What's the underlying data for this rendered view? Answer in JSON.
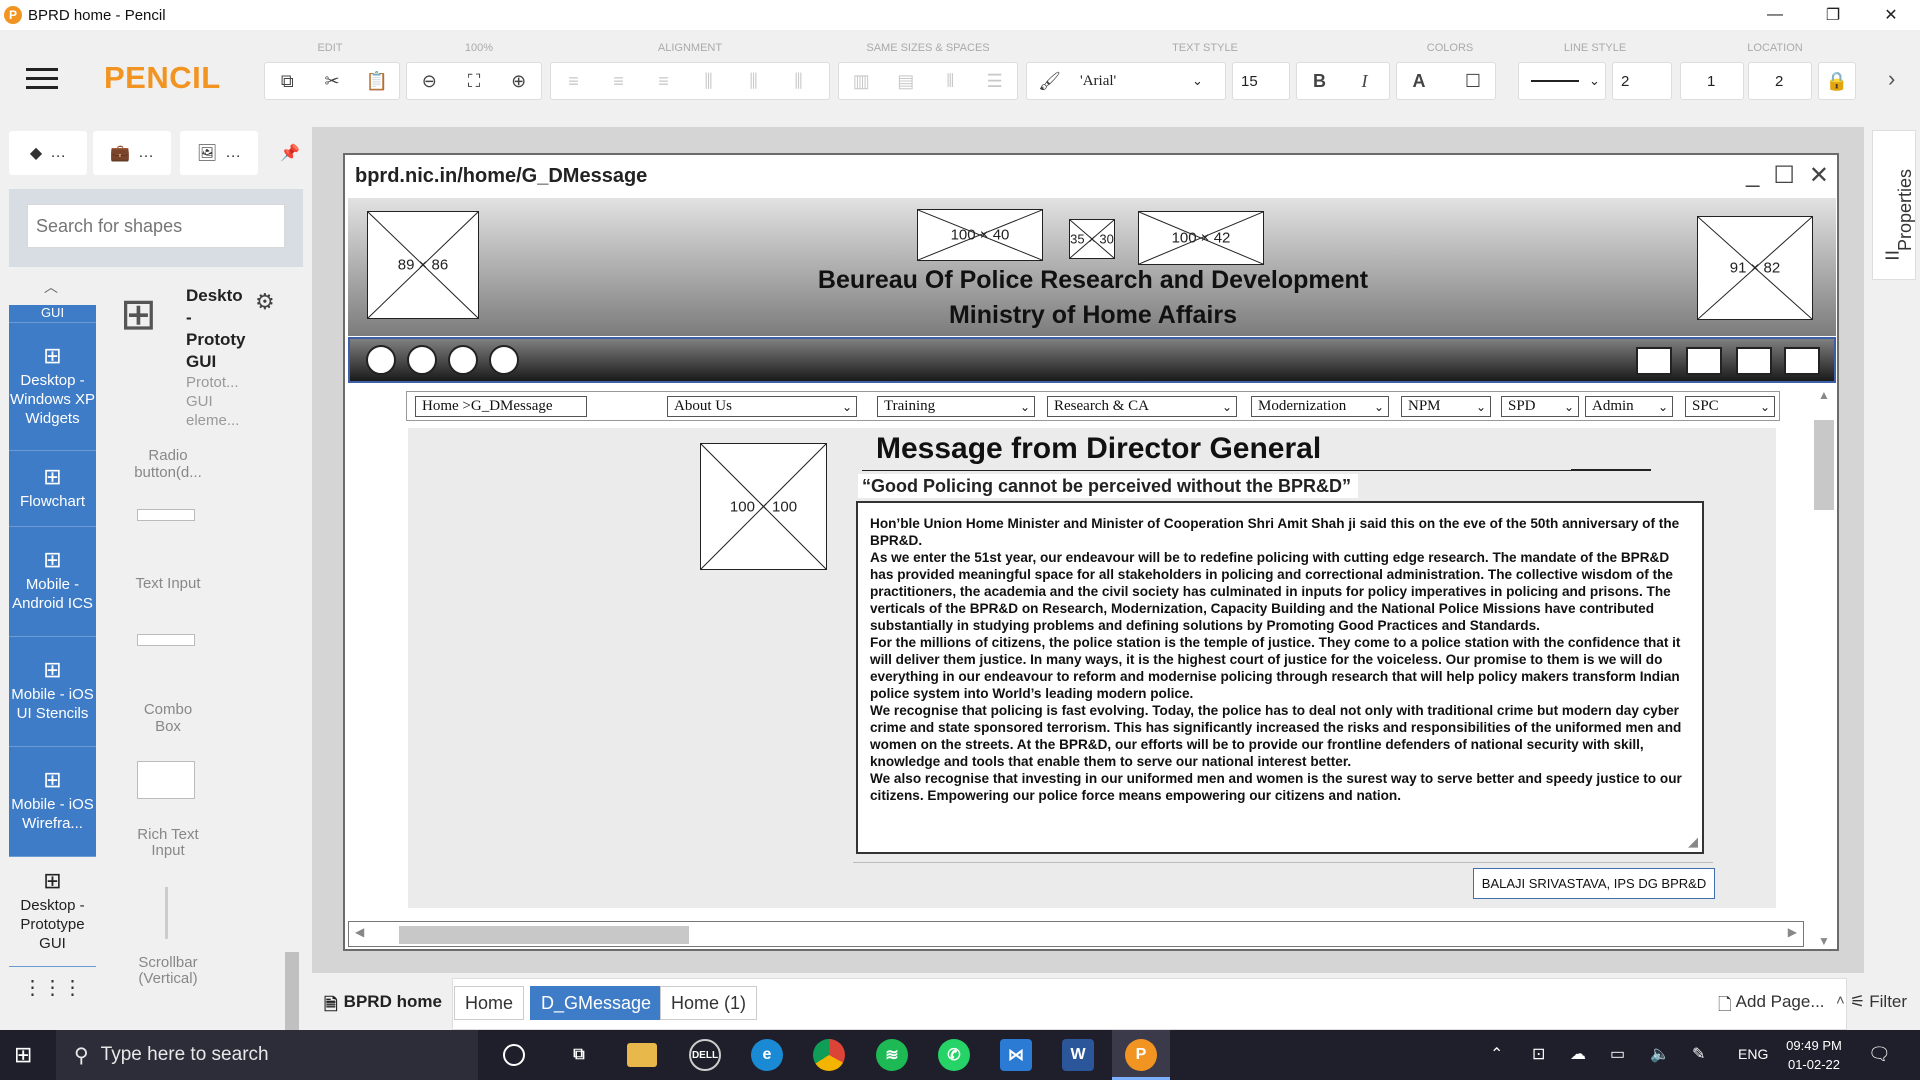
{
  "window": {
    "title": "BPRD home - Pencil",
    "min": "—",
    "max": "❐",
    "close": "✕"
  },
  "app": {
    "brand": "PENCIL",
    "menu_icon": "hamburger-icon"
  },
  "toolbar": {
    "groups": [
      "EDIT",
      "100%",
      "ALIGNMENT",
      "SAME SIZES & SPACES",
      "TEXT STYLE",
      "COLORS",
      "LINE STYLE",
      "LOCATION"
    ],
    "font_family": "'Arial'",
    "font_size": "15",
    "bold": "B",
    "italic": "I",
    "text_color": "A",
    "line_width": "2",
    "loc_x": "1",
    "loc_y": "2",
    "chevron": "›"
  },
  "left_panel": {
    "tabs": [
      "…",
      "…",
      "…"
    ],
    "search_placeholder": "Search for shapes",
    "categories": [
      {
        "label": "GUI"
      },
      {
        "label": "Desktop - Windows XP Widgets"
      },
      {
        "label": "Flowchart"
      },
      {
        "label": "Mobile - Android ICS"
      },
      {
        "label": "Mobile - iOS UI Stencils"
      },
      {
        "label": "Mobile - iOS Wirefra..."
      },
      {
        "label": "Desktop - Prototype GUI"
      }
    ],
    "collection": {
      "title": "Deskto - Prototy GUI",
      "desc": "Protot... GUI eleme... for"
    },
    "shapes": [
      "Radio button(d...",
      "Text Input",
      "Combo Box",
      "Rich Text Input",
      "Scrollbar (Vertical)"
    ]
  },
  "properties_tab": "Properties",
  "mock": {
    "url": "bprd.nic.in/home/G_DMessage",
    "placeholders": {
      "logo_left": "89 × 86",
      "top1": "100 × 40",
      "top2": "35 × 30",
      "top3": "100 × 42",
      "logo_right": "91 × 82",
      "portrait": "100 × 100"
    },
    "header_line1": "Beureau Of Police Research and Development",
    "header_line2": "Ministry of Home Affairs",
    "breadcrumb": "Home >G_DMessage",
    "menus": [
      "About Us",
      "Training",
      "Research & CA",
      "Modernization",
      "NPM",
      "SPD",
      "Admin",
      "SPC"
    ],
    "heading": "Message from Director General",
    "quote": "“Good Policing cannot be perceived without the BPR&D”",
    "paragraphs": [
      "Hon’ble Union Home Minister and Minister of Cooperation Shri Amit Shah ji said this on the eve of the 50th anniversary of the BPR&D.",
      "As we enter the 51st year, our endeavour will be to redefine policing with cutting edge research. The mandate of the BPR&D has provided meaningful space for all stakeholders in policing and correctional administration. The collective wisdom of the practitioners, the academia and the civil society has culminated in inputs for policy imperatives in policing and prisons. The verticals of the BPR&D on Research, Modernization, Capacity Building and the National Police Missions have contributed substantially in studying problems and defining solutions by Promoting Good Practices and Standards.",
      "For the millions of citizens, the police station is the temple of justice. They come to a police station with the confidence that it will deliver them justice. In many ways, it is the highest court of justice for the voiceless. Our promise to them is we will do everything in our endeavour to reform and modernise policing through research that will help policy makers transform Indian police system into World’s leading modern police.",
      "We recognise that policing is fast evolving. Today, the police has to deal not only with traditional crime but modern day cyber crime and state sponsored terrorism. This has significantly increased the risks and responsibilities of the uniformed men and women on the streets. At the BPR&D, our efforts will be to provide our frontline defenders of national security with skill, knowledge and tools that enable them to serve our national interest better.",
      "We also recognise that investing in our uniformed men and women is the surest way to serve better and speedy justice to our citizens. Empowering our police force means empowering our citizens and nation."
    ],
    "signature": "BALAJI SRIVASTAVA, IPS DG BPR&D"
  },
  "pages": {
    "doc": "BPRD home",
    "tabs": [
      "Home",
      "D_GMessage",
      "Home (1)"
    ],
    "active": "D_GMessage",
    "filter": "Filter",
    "add_page": "Add Page..."
  },
  "taskbar": {
    "search_placeholder": "Type here to search",
    "lang": "ENG",
    "time": "09:49 PM",
    "date": "01-02-22"
  },
  "colors": {
    "accent": "#3f7cc7",
    "brand": "#f29422"
  }
}
